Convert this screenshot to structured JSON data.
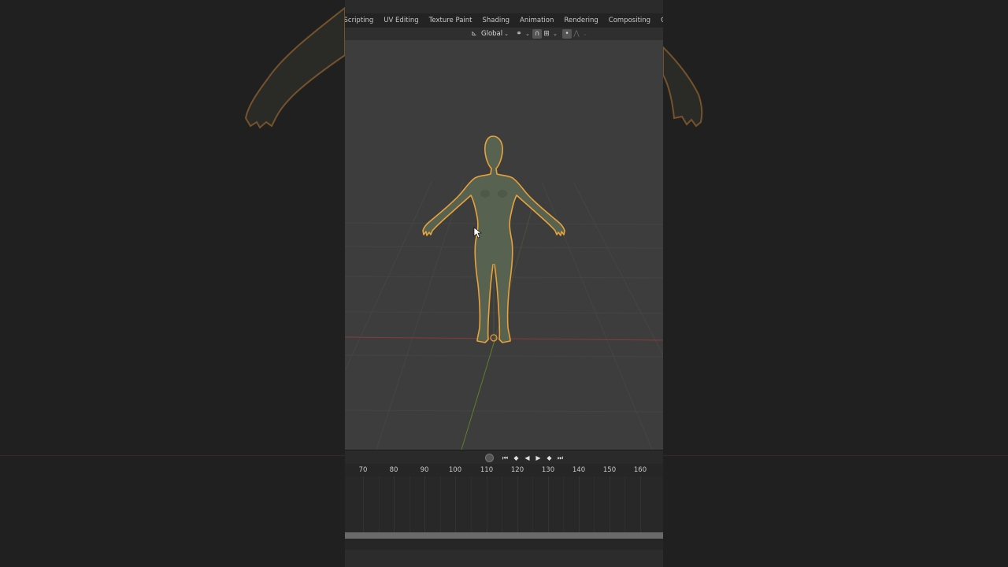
{
  "workspace_tabs": [
    "Scripting",
    "UV Editing",
    "Texture Paint",
    "Shading",
    "Animation",
    "Rendering",
    "Compositing",
    "Geometry Nodes"
  ],
  "header": {
    "transform_orientation": "Global"
  },
  "timeline": {
    "frame_numbers": [
      "70",
      "80",
      "90",
      "100",
      "110",
      "120",
      "130",
      "140",
      "150",
      "160"
    ]
  },
  "colors": {
    "selection_outline": "#e8a23c",
    "mesh": "#5c6654",
    "x_axis": "#9a3c3c",
    "y_axis": "#6a8a2a"
  }
}
